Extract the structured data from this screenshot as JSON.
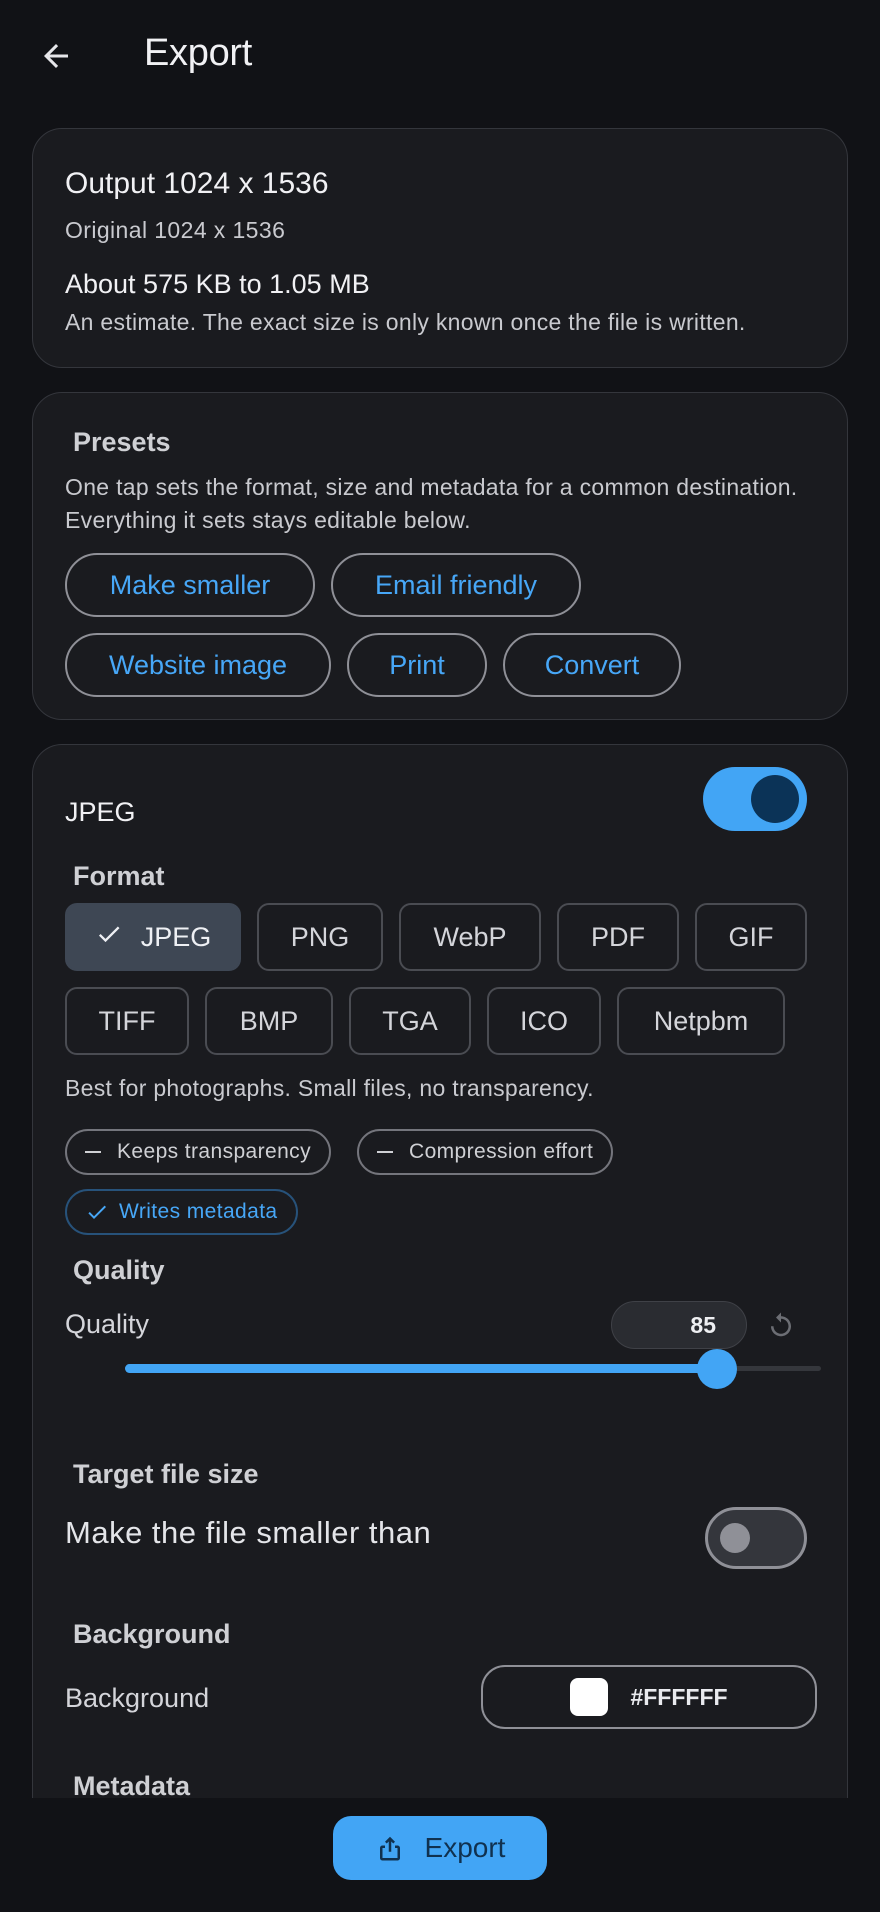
{
  "header": {
    "title": "Export"
  },
  "summary": {
    "output": "Output 1024 x 1536",
    "original": "Original 1024 x 1536",
    "size_estimate": "About 575 KB to 1.05 MB",
    "size_note": "An estimate. The exact size is only known once the file is written."
  },
  "presets": {
    "title": "Presets",
    "description": "One tap sets the format, size and metadata for a common destination. Everything it sets stays editable below.",
    "buttons": [
      "Make smaller",
      "Email friendly",
      "Website image",
      "Print",
      "Convert"
    ]
  },
  "format_section": {
    "format_name": "JPEG",
    "enabled": true,
    "title": "Format",
    "formats": [
      "JPEG",
      "PNG",
      "WebP",
      "PDF",
      "GIF",
      "TIFF",
      "BMP",
      "TGA",
      "ICO",
      "Netpbm"
    ],
    "selected": "JPEG",
    "description": "Best for photographs. Small files, no transparency.",
    "features": [
      {
        "label": "Keeps transparency",
        "supported": false
      },
      {
        "label": "Compression effort",
        "supported": false
      },
      {
        "label": "Writes metadata",
        "supported": true
      }
    ]
  },
  "quality": {
    "section_title": "Quality",
    "label": "Quality",
    "value": "85",
    "slider_fraction": 0.85
  },
  "target_size": {
    "section_title": "Target file size",
    "label": "Make the file smaller than",
    "enabled": false
  },
  "background": {
    "section_title": "Background",
    "label": "Background",
    "color": "#FFFFFF"
  },
  "metadata": {
    "section_title": "Metadata"
  },
  "footer": {
    "export_label": "Export"
  },
  "colors": {
    "accent": "#42a5f5",
    "background": "#111216",
    "card": "#1a1b1f"
  }
}
